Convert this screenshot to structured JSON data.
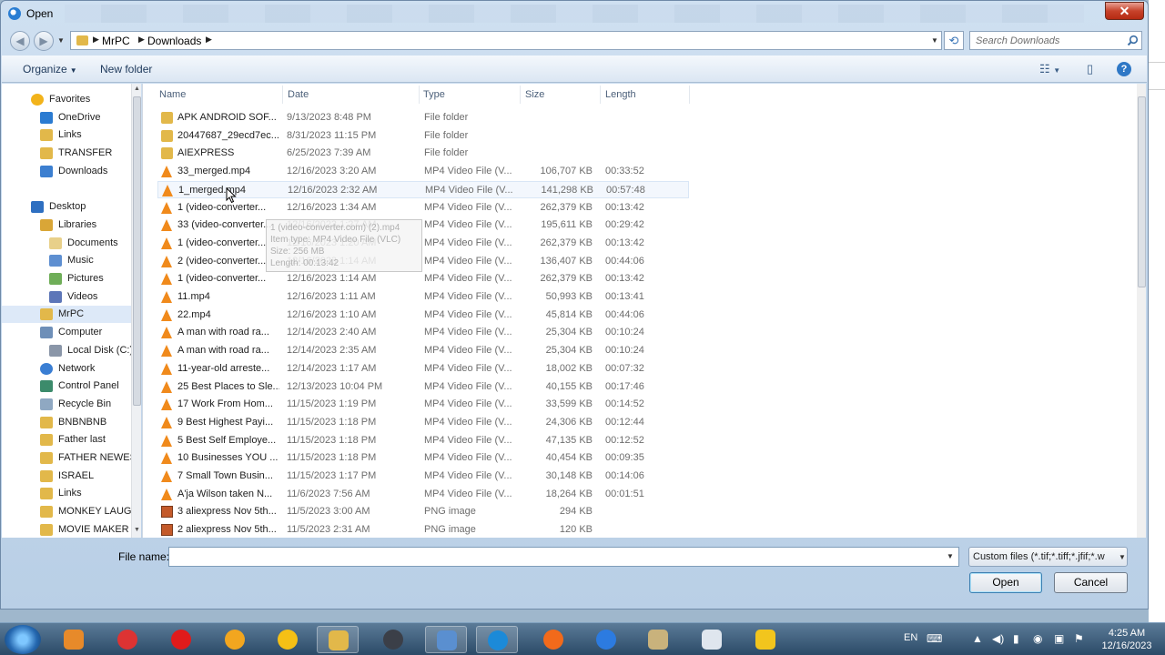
{
  "window": {
    "title": "Open",
    "close_label": "✕"
  },
  "address": {
    "crumbs": [
      "MrPC",
      "Downloads"
    ]
  },
  "search": {
    "placeholder": "Search Downloads"
  },
  "toolbar": {
    "organize": "Organize",
    "new_folder": "New folder"
  },
  "nav": {
    "items": [
      {
        "label": "Favorites",
        "icon": "star-icon",
        "indent": 0
      },
      {
        "label": "OneDrive",
        "icon": "onedrive-icon",
        "indent": 1
      },
      {
        "label": "Links",
        "icon": "folder-icon",
        "indent": 1
      },
      {
        "label": "TRANSFER",
        "icon": "folder-icon",
        "indent": 1
      },
      {
        "label": "Downloads",
        "icon": "downloads-icon",
        "indent": 1
      },
      {
        "label": "",
        "icon": "",
        "indent": 0
      },
      {
        "label": "Desktop",
        "icon": "desktop-icon",
        "indent": 0
      },
      {
        "label": "Libraries",
        "icon": "libraries-icon",
        "indent": 1
      },
      {
        "label": "Documents",
        "icon": "documents-icon",
        "indent": 2
      },
      {
        "label": "Music",
        "icon": "music-icon",
        "indent": 2
      },
      {
        "label": "Pictures",
        "icon": "pictures-icon",
        "indent": 2
      },
      {
        "label": "Videos",
        "icon": "videos-icon",
        "indent": 2
      },
      {
        "label": "MrPC",
        "icon": "user-folder-icon",
        "indent": 1,
        "selected": true
      },
      {
        "label": "Computer",
        "icon": "computer-icon",
        "indent": 1
      },
      {
        "label": "Local Disk (C:)",
        "icon": "disk-icon",
        "indent": 2
      },
      {
        "label": "Network",
        "icon": "network-icon",
        "indent": 1
      },
      {
        "label": "Control Panel",
        "icon": "control-panel-icon",
        "indent": 1
      },
      {
        "label": "Recycle Bin",
        "icon": "recycle-bin-icon",
        "indent": 1
      },
      {
        "label": "BNBNBNB",
        "icon": "folder-icon",
        "indent": 1
      },
      {
        "label": "Father last",
        "icon": "folder-icon",
        "indent": 1
      },
      {
        "label": "FATHER NEWEST",
        "icon": "folder-icon",
        "indent": 1
      },
      {
        "label": "ISRAEL",
        "icon": "folder-icon",
        "indent": 1
      },
      {
        "label": "Links",
        "icon": "folder-icon",
        "indent": 1
      },
      {
        "label": "MONKEY LAUGH",
        "icon": "folder-icon",
        "indent": 1
      },
      {
        "label": "MOVIE MAKER",
        "icon": "folder-icon",
        "indent": 1
      }
    ]
  },
  "columns": {
    "name": "Name",
    "date": "Date",
    "type": "Type",
    "size": "Size",
    "length": "Length"
  },
  "files": [
    {
      "name": "APK ANDROID SOF...",
      "date": "9/13/2023 8:48 PM",
      "type": "File folder",
      "size": "",
      "length": "",
      "kind": "folder"
    },
    {
      "name": "20447687_29ecd7ec...",
      "date": "8/31/2023 11:15 PM",
      "type": "File folder",
      "size": "",
      "length": "",
      "kind": "folder"
    },
    {
      "name": "AIEXPRESS",
      "date": "6/25/2023 7:39 AM",
      "type": "File folder",
      "size": "",
      "length": "",
      "kind": "folder"
    },
    {
      "name": "33_merged.mp4",
      "date": "12/16/2023 3:20 AM",
      "type": "MP4 Video File (V...",
      "size": "106,707 KB",
      "length": "00:33:52",
      "kind": "vlc"
    },
    {
      "name": "1_merged.mp4",
      "date": "12/16/2023 2:32 AM",
      "type": "MP4 Video File (V...",
      "size": "141,298 KB",
      "length": "00:57:48",
      "kind": "vlc",
      "hover": true
    },
    {
      "name": "1 (video-converter...",
      "date": "12/16/2023 1:34 AM",
      "type": "MP4 Video File (V...",
      "size": "262,379 KB",
      "length": "00:13:42",
      "kind": "vlc"
    },
    {
      "name": "33 (video-converter...",
      "date": "12/16/2023 1:27 AM",
      "type": "MP4 Video File (V...",
      "size": "195,611 KB",
      "length": "00:29:42",
      "kind": "vlc"
    },
    {
      "name": "1 (video-converter...",
      "date": "12/16/2023 1:20 AM",
      "type": "MP4 Video File (V...",
      "size": "262,379 KB",
      "length": "00:13:42",
      "kind": "vlc"
    },
    {
      "name": "2 (video-converter...",
      "date": "12/16/2023 1:14 AM",
      "type": "MP4 Video File (V...",
      "size": "136,407 KB",
      "length": "00:44:06",
      "kind": "vlc"
    },
    {
      "name": "1 (video-converter...",
      "date": "12/16/2023 1:14 AM",
      "type": "MP4 Video File (V...",
      "size": "262,379 KB",
      "length": "00:13:42",
      "kind": "vlc"
    },
    {
      "name": "11.mp4",
      "date": "12/16/2023 1:11 AM",
      "type": "MP4 Video File (V...",
      "size": "50,993 KB",
      "length": "00:13:41",
      "kind": "vlc"
    },
    {
      "name": "22.mp4",
      "date": "12/16/2023 1:10 AM",
      "type": "MP4 Video File (V...",
      "size": "45,814 KB",
      "length": "00:44:06",
      "kind": "vlc"
    },
    {
      "name": "A man with road ra...",
      "date": "12/14/2023 2:40 AM",
      "type": "MP4 Video File (V...",
      "size": "25,304 KB",
      "length": "00:10:24",
      "kind": "vlc"
    },
    {
      "name": "A man with road ra...",
      "date": "12/14/2023 2:35 AM",
      "type": "MP4 Video File (V...",
      "size": "25,304 KB",
      "length": "00:10:24",
      "kind": "vlc"
    },
    {
      "name": "11-year-old arreste...",
      "date": "12/14/2023 1:17 AM",
      "type": "MP4 Video File (V...",
      "size": "18,002 KB",
      "length": "00:07:32",
      "kind": "vlc"
    },
    {
      "name": "25 Best Places to Sle...",
      "date": "12/13/2023 10:04 PM",
      "type": "MP4 Video File (V...",
      "size": "40,155 KB",
      "length": "00:17:46",
      "kind": "vlc"
    },
    {
      "name": "17 Work From Hom...",
      "date": "11/15/2023 1:19 PM",
      "type": "MP4 Video File (V...",
      "size": "33,599 KB",
      "length": "00:14:52",
      "kind": "vlc"
    },
    {
      "name": "9 Best Highest Payi...",
      "date": "11/15/2023 1:18 PM",
      "type": "MP4 Video File (V...",
      "size": "24,306 KB",
      "length": "00:12:44",
      "kind": "vlc"
    },
    {
      "name": "5 Best Self Employe...",
      "date": "11/15/2023 1:18 PM",
      "type": "MP4 Video File (V...",
      "size": "47,135 KB",
      "length": "00:12:52",
      "kind": "vlc"
    },
    {
      "name": "10 Businesses YOU ...",
      "date": "11/15/2023 1:18 PM",
      "type": "MP4 Video File (V...",
      "size": "40,454 KB",
      "length": "00:09:35",
      "kind": "vlc"
    },
    {
      "name": "7 Small Town Busin...",
      "date": "11/15/2023 1:17 PM",
      "type": "MP4 Video File (V...",
      "size": "30,148 KB",
      "length": "00:14:06",
      "kind": "vlc"
    },
    {
      "name": "A'ja Wilson taken N...",
      "date": "11/6/2023 7:56 AM",
      "type": "MP4 Video File (V...",
      "size": "18,264 KB",
      "length": "00:01:51",
      "kind": "vlc"
    },
    {
      "name": "3 aliexpress Nov 5th...",
      "date": "11/5/2023 3:00 AM",
      "type": "PNG image",
      "size": "294 KB",
      "length": "",
      "kind": "png"
    },
    {
      "name": "2 aliexpress Nov 5th...",
      "date": "11/5/2023 2:31 AM",
      "type": "PNG image",
      "size": "120 KB",
      "length": "",
      "kind": "png"
    }
  ],
  "tooltip": {
    "line1": "1 (video-converter.com) (2).mp4",
    "line2": "Item type: MP4 Video File (VLC)",
    "line3": "Size: 256 MB",
    "line4": "Length: 00:13:42"
  },
  "bottom": {
    "file_name_label": "File name:",
    "file_name_value": "",
    "filter": "Custom files (*.tif;*.tiff;*.jfif;*.w",
    "open": "Open",
    "cancel": "Cancel"
  },
  "taskbar": {
    "lang": "EN",
    "time": "4:25 AM",
    "date": "12/16/2023"
  },
  "colors": {
    "folder": "#e2b84a",
    "vlc": "#f08a1c",
    "accent": "#3c7fb1"
  }
}
